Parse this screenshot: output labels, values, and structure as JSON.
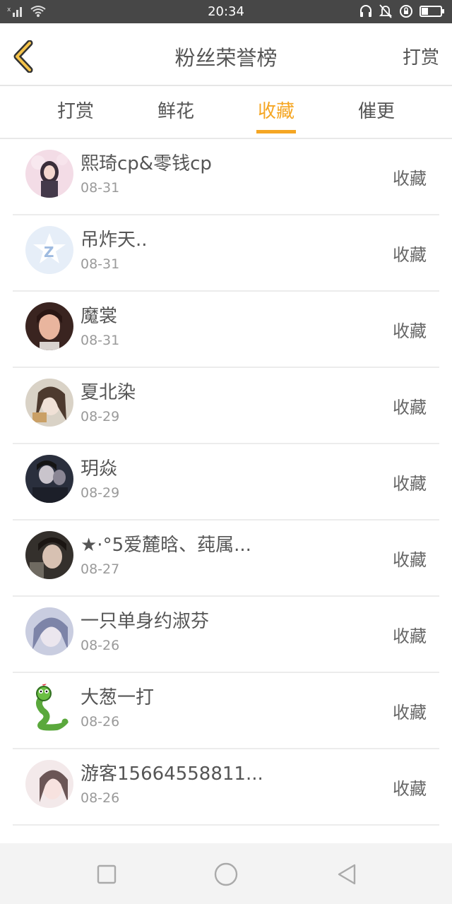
{
  "status_bar": {
    "time": "20:34",
    "icons_left": [
      "signal-icon",
      "wifi-icon"
    ],
    "icons_right": [
      "headphones-icon",
      "bell-off-icon",
      "lock-rotation-icon",
      "battery-icon"
    ]
  },
  "header": {
    "back_icon": "chevron-left-icon",
    "title": "粉丝荣誉榜",
    "action": "打赏"
  },
  "tabs": [
    {
      "label": "打赏",
      "active": false
    },
    {
      "label": "鲜花",
      "active": false
    },
    {
      "label": "收藏",
      "active": true
    },
    {
      "label": "催更",
      "active": false
    }
  ],
  "accent_color": "#f5a623",
  "list": [
    {
      "name": "熙琦cp&零钱cp",
      "date": "08-31",
      "action": "收藏"
    },
    {
      "name": "吊炸天..",
      "date": "08-31",
      "action": "收藏"
    },
    {
      "name": "魔裳",
      "date": "08-31",
      "action": "收藏"
    },
    {
      "name": "夏北染",
      "date": "08-29",
      "action": "收藏"
    },
    {
      "name": "玥焱",
      "date": "08-29",
      "action": "收藏"
    },
    {
      "name": "★·°5爱麓晗、莼属...",
      "date": "08-27",
      "action": "收藏"
    },
    {
      "name": "一只单身约淑芬",
      "date": "08-26",
      "action": "收藏"
    },
    {
      "name": "大葱一打",
      "date": "08-26",
      "action": "收藏"
    },
    {
      "name": "游客15664558811...",
      "date": "08-26",
      "action": "收藏"
    }
  ],
  "nav_bar": {
    "icons": [
      "recent-apps-icon",
      "home-icon",
      "back-icon"
    ]
  }
}
